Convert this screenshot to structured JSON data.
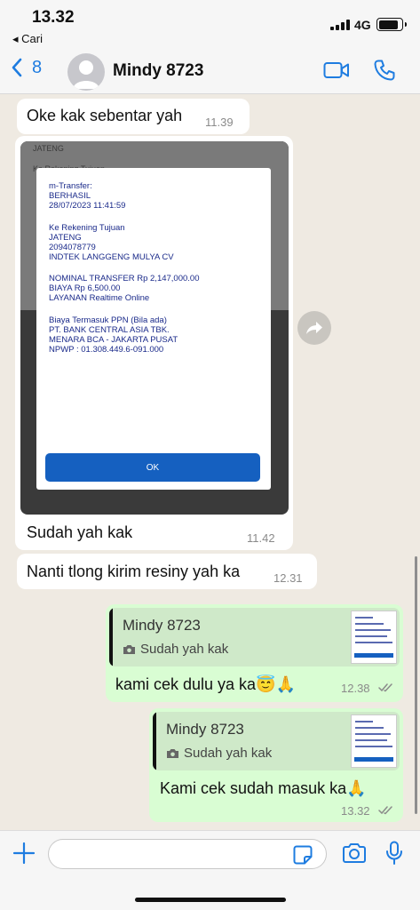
{
  "status_bar": {
    "time": "13.32",
    "back_app": "◂ Cari",
    "network": "4G",
    "battery_level": 0.85
  },
  "header": {
    "back_count": "8",
    "contact_name": "Mindy 8723"
  },
  "messages": [
    {
      "direction": "in",
      "text": "Oke kak sebentar yah",
      "time": "11.39"
    },
    {
      "direction": "in",
      "type": "image",
      "caption": "Sudah yah kak",
      "time": "11.42",
      "image": {
        "background_lines": [
          "JATENG",
          "Ke Rekening Tujuan"
        ],
        "lines": [
          "m-Transfer:",
          "BERHASIL",
          "28/07/2023 11:41:59",
          "Ke Rekening Tujuan",
          "JATENG",
          "2094078779",
          "INDTEK LANGGENG MULYA CV",
          "NOMINAL TRANSFER Rp 2,147,000.00",
          "BIAYA Rp 6,500.00",
          "LAYANAN Realtime Online",
          "Biaya Termasuk PPN (Bila ada)",
          "PT. BANK CENTRAL ASIA TBK.",
          "MENARA BCA - JAKARTA PUSAT",
          "NPWP : 01.308.449.6-091.000"
        ],
        "ok_label": "OK"
      }
    },
    {
      "direction": "in",
      "text": "Nanti tlong kirim resiny yah ka",
      "time": "12.31"
    },
    {
      "direction": "out",
      "reply_to": {
        "name": "Mindy 8723",
        "text": "Sudah yah kak"
      },
      "text": "kami cek dulu ya ka😇🙏",
      "time": "12.38"
    },
    {
      "direction": "out",
      "reply_to": {
        "name": "Mindy 8723",
        "text": "Sudah yah kak"
      },
      "text": "Kami cek sudah masuk ka🙏",
      "time": "13.32"
    }
  ],
  "input": {
    "value": "",
    "placeholder": ""
  },
  "colors": {
    "accent": "#1e7ce0",
    "incoming": "#ffffff",
    "outgoing": "#d9fdd3",
    "background": "#efeae2"
  },
  "icons": [
    "back-chevron-icon",
    "video-call-icon",
    "phone-icon",
    "forward-icon",
    "camera-icon",
    "plus-icon",
    "sticker-icon",
    "microphone-icon",
    "double-check-icon"
  ]
}
